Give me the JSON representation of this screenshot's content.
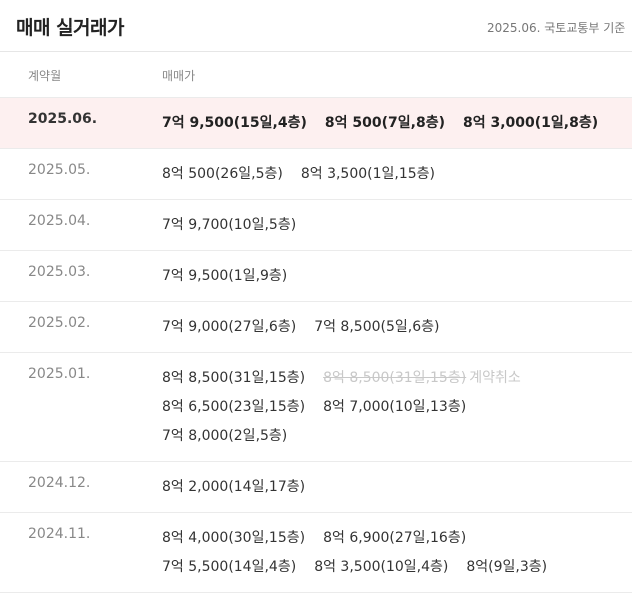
{
  "header": {
    "title": "매매 실거래가",
    "source": "2025.06. 국토교통부 기준"
  },
  "columns": {
    "month": "계약월",
    "price": "매매가"
  },
  "rows": [
    {
      "month": "2025.06.",
      "highlight": true,
      "lines": [
        [
          {
            "text": "7억 9,500(15일,4층)"
          },
          {
            "text": "8억 500(7일,8층)"
          },
          {
            "text": "8억 3,000(1일,8층)"
          }
        ]
      ]
    },
    {
      "month": "2025.05.",
      "lines": [
        [
          {
            "text": "8억 500(26일,5층)"
          },
          {
            "text": "8억 3,500(1일,15층)"
          }
        ]
      ]
    },
    {
      "month": "2025.04.",
      "lines": [
        [
          {
            "text": "7억 9,700(10일,5층)"
          }
        ]
      ]
    },
    {
      "month": "2025.03.",
      "lines": [
        [
          {
            "text": "7억 9,500(1일,9층)"
          }
        ]
      ]
    },
    {
      "month": "2025.02.",
      "lines": [
        [
          {
            "text": "7억 9,000(27일,6층)"
          },
          {
            "text": "7억 8,500(5일,6층)"
          }
        ]
      ]
    },
    {
      "month": "2025.01.",
      "lines": [
        [
          {
            "text": "8억 8,500(31일,15층)"
          },
          {
            "text": "8억 8,500(31일,15층)",
            "cancelled": true,
            "cancel_label": "계약취소"
          }
        ],
        [
          {
            "text": "8억 6,500(23일,15층)"
          },
          {
            "text": "8억 7,000(10일,13층)"
          }
        ],
        [
          {
            "text": "7억 8,000(2일,5층)"
          }
        ]
      ]
    },
    {
      "month": "2024.12.",
      "lines": [
        [
          {
            "text": "8억 2,000(14일,17층)"
          }
        ]
      ]
    },
    {
      "month": "2024.11.",
      "lines": [
        [
          {
            "text": "8억 4,000(30일,15층)"
          },
          {
            "text": "8억 6,900(27일,16층)"
          }
        ],
        [
          {
            "text": "7억 5,500(14일,4층)"
          },
          {
            "text": "8억 3,500(10일,4층)"
          },
          {
            "text": "8억(9일,3층)"
          }
        ]
      ]
    }
  ]
}
